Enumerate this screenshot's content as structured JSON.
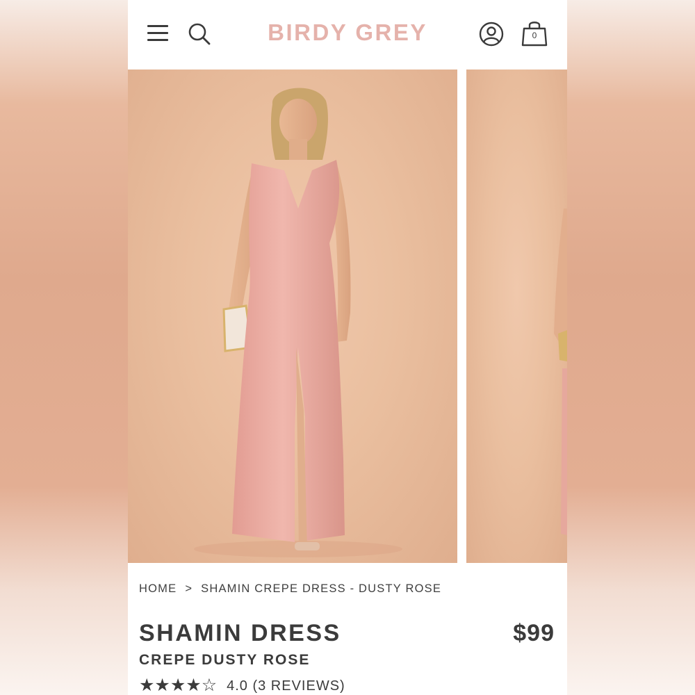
{
  "header": {
    "logo": "BIRDY GREY",
    "cart_count": "0"
  },
  "icons": {
    "menu": "hamburger-menu-icon",
    "search": "search-icon",
    "account": "account-icon",
    "bag": "shopping-bag-icon"
  },
  "gallery": {
    "images": [
      {
        "alt": "model wearing dress front view"
      },
      {
        "alt": "model wearing dress side view"
      }
    ]
  },
  "breadcrumb": {
    "home": "HOME",
    "separator": ">",
    "current": "SHAMIN CREPE DRESS - DUSTY ROSE"
  },
  "product": {
    "title": "SHAMIN DRESS",
    "subtitle": "CREPE DUSTY ROSE",
    "price": "$99",
    "rating_value": 4.0,
    "rating_max": 5,
    "rating_text": "4.0 (3 REVIEWS)"
  },
  "colors": {
    "logo": "#e5b2ab",
    "text": "#3b3b3b",
    "photo_bg": "#eabf9f",
    "dress": "#e9aaa0"
  }
}
